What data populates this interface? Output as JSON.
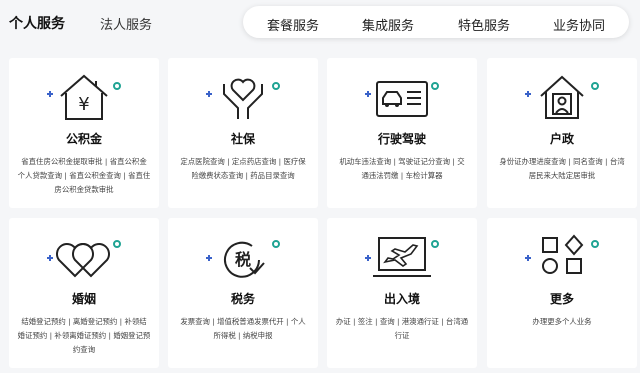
{
  "tabs": {
    "personal": "个人服务",
    "legal": "法人服务"
  },
  "pill_nav": [
    "套餐服务",
    "集成服务",
    "特色服务",
    "业务协同"
  ],
  "colors": {
    "accent_plus": "#3a62c9",
    "accent_ring": "#1fa393",
    "icon_stroke": "#222222"
  },
  "cards": [
    {
      "title": "公积金",
      "icon": "house-yuan-icon",
      "desc": [
        "省直住房公积金提取审批 | 省直公积金",
        "个人贷款查询 | 省直公积金查询 | 省直住",
        "房公积金贷款审批"
      ]
    },
    {
      "title": "社保",
      "icon": "heart-hands-icon",
      "desc": [
        "定点医院查询 | 定点药店查询 | 医疗保",
        "险缴费状态查询 | 药品目录查询"
      ]
    },
    {
      "title": "行驶驾驶",
      "icon": "driving-license-icon",
      "desc": [
        "机动车违法查询 | 驾驶证记分查询 | 交",
        "通违法罚缴 | 车检计算器"
      ]
    },
    {
      "title": "户政",
      "icon": "house-person-icon",
      "desc": [
        "身份证办理进度查询 | 同名查询 | 台湾",
        "居民来大陆定居审批"
      ]
    },
    {
      "title": "婚姻",
      "icon": "double-heart-icon",
      "desc": [
        "结婚登记预约 | 离婚登记预约 | 补领结",
        "婚证预约 | 补领离婚证预约 | 婚姻登记预",
        "约查询"
      ]
    },
    {
      "title": "税务",
      "icon": "tax-icon",
      "desc": [
        "发票查询 | 增值税普通发票代开 | 个人",
        "所得税 | 纳税申报"
      ]
    },
    {
      "title": "出入境",
      "icon": "airplane-ticket-icon",
      "desc": [
        "办证 | 签注 | 查询 | 港澳通行证 | 台湾通",
        "行证"
      ]
    },
    {
      "title": "更多",
      "icon": "apps-grid-icon",
      "desc": [
        "办理更多个人业务"
      ]
    }
  ],
  "icon_glyphs": {
    "yuan": "¥",
    "tax": "税"
  }
}
